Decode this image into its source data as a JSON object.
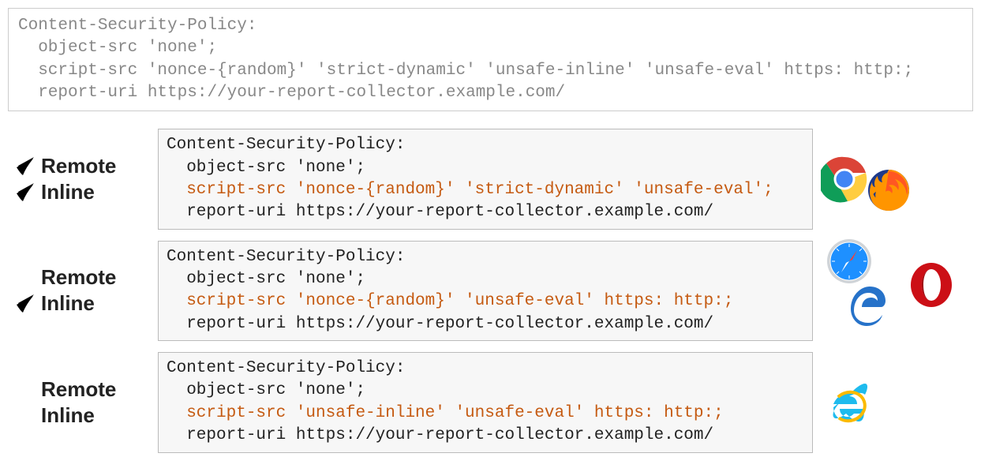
{
  "top_box": {
    "l1": "Content-Security-Policy:",
    "l2": "  object-src 'none';",
    "l3": "  script-src 'nonce-{random}' 'strict-dynamic' 'unsafe-inline' 'unsafe-eval' https: http:;",
    "l4": "  report-uri https://your-report-collector.example.com/"
  },
  "labels": {
    "remote": "Remote",
    "inline": "Inline"
  },
  "row1": {
    "remote_ok": true,
    "inline_ok": true,
    "code": {
      "l1": "Content-Security-Policy:",
      "l2": "  object-src 'none';",
      "l3": "  script-src 'nonce-{random}' 'strict-dynamic' 'unsafe-eval';",
      "l4": "  report-uri https://your-report-collector.example.com/"
    },
    "browsers": [
      "chrome",
      "firefox"
    ]
  },
  "row2": {
    "remote_ok": false,
    "inline_ok": true,
    "code": {
      "l1": "Content-Security-Policy:",
      "l2": "  object-src 'none';",
      "l3": "  script-src 'nonce-{random}' 'unsafe-eval' https: http:;",
      "l4": "  report-uri https://your-report-collector.example.com/"
    },
    "browsers": [
      "safari",
      "edge",
      "opera"
    ]
  },
  "row3": {
    "remote_ok": false,
    "inline_ok": false,
    "code": {
      "l1": "Content-Security-Policy:",
      "l2": "  object-src 'none';",
      "l3": "  script-src 'unsafe-inline' 'unsafe-eval' https: http:;",
      "l4": "  report-uri https://your-report-collector.example.com/"
    },
    "browsers": [
      "ie"
    ]
  },
  "colors": {
    "highlight": "#c55a11",
    "check": "#1a8a2a",
    "cross": "#c0282d"
  }
}
